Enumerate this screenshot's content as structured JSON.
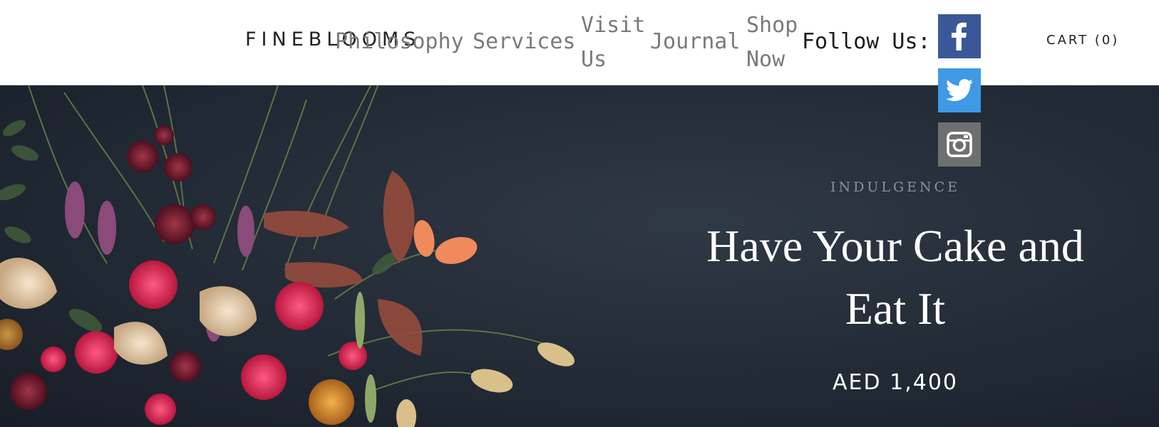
{
  "header": {
    "logo": "FINEBLOOMS",
    "nav": {
      "philosophy": "Philosophy",
      "services": "Services",
      "visit": "Visit Us",
      "journal": "Journal",
      "shop": "Shop Now"
    },
    "follow_label": "Follow Us:",
    "social": {
      "facebook_icon": "facebook-icon",
      "twitter_icon": "twitter-icon",
      "instagram_icon": "instagram-icon"
    },
    "cart": {
      "label": "CART",
      "count": "(0)"
    }
  },
  "hero": {
    "eyebrow": "INDULGENCE",
    "title": "Have Your Cake and Eat It",
    "price": "AED 1,400"
  },
  "colors": {
    "facebook": "#3a5898",
    "twitter": "#3f99e4",
    "instagram": "#6f6f6f",
    "hero_background": "#222a35"
  }
}
